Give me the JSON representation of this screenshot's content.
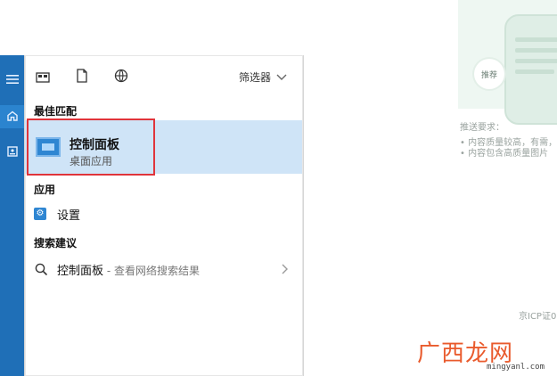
{
  "background_page": {
    "illustration": {
      "bubble_text": "推荐"
    },
    "push_requirements_title": "推送要求：",
    "bullets": [
      "• 内容质量较高，有需，",
      "• 内容包含高质量图片"
    ],
    "footer_icp": "京ICP证0"
  },
  "watermark": {
    "brand": "广西龙网",
    "url": "mingyanl.com"
  },
  "start_menu": {
    "filter_label": "筛选器",
    "sections": {
      "best_match": "最佳匹配",
      "apps": "应用",
      "search_suggestions": "搜索建议"
    },
    "best_match_item": {
      "title": "控制面板",
      "subtitle": "桌面应用"
    },
    "apps": [
      {
        "label": "设置"
      }
    ],
    "suggestions": [
      {
        "query": "控制面板",
        "suffix": " - 查看网络搜索结果"
      }
    ]
  }
}
